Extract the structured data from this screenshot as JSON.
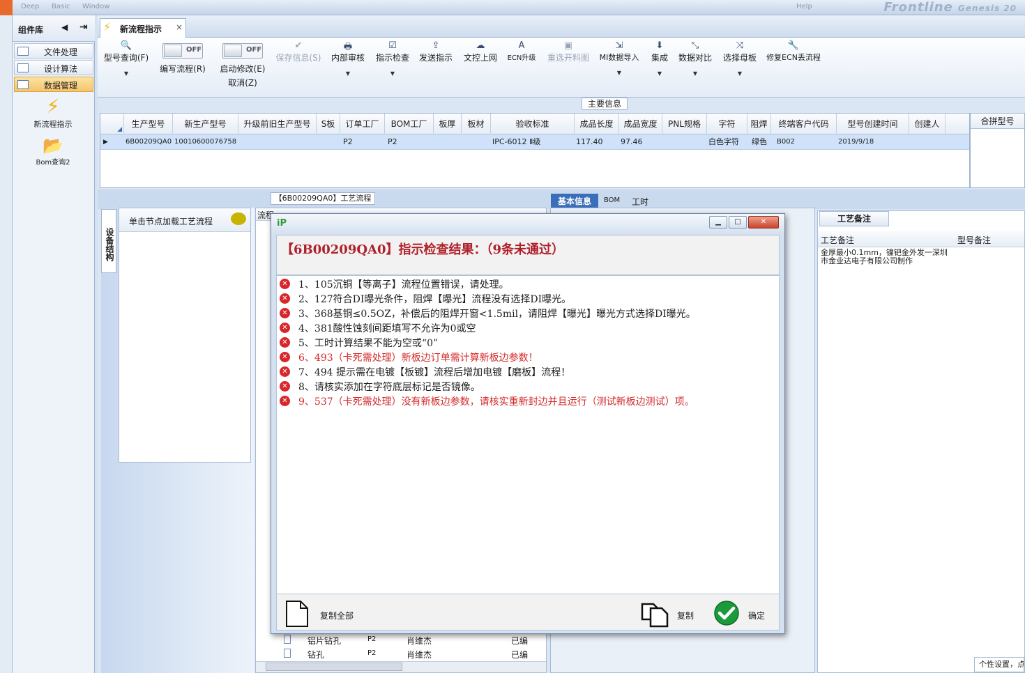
{
  "topbar": {
    "menus": [
      "Deep",
      "Basic",
      "Window"
    ],
    "brand": "Frontline",
    "help": "Help",
    "genesis": "Genesis 20"
  },
  "nav": {
    "title": "组件库",
    "items": [
      "文件处理",
      "设计算法",
      "数据管理"
    ],
    "tools": [
      "新流程指示",
      "Bom查询2"
    ]
  },
  "tab": {
    "label": "新流程指示",
    "close": "×"
  },
  "ribbon": {
    "model_query": "型号查询(F)",
    "write_flow": "编写流程(R)",
    "start_modify": "启动修改(E)",
    "cancel": "取消(Z)",
    "switch_off": "OFF",
    "save_info": "保存信息(S)",
    "internal_review": "内部审核",
    "check": "指示检查",
    "send": "发送指示",
    "upload": "文控上网",
    "ecn_upgrade": "ECN升级",
    "reselect": "重选开料图",
    "mi_import": "MI数据导入",
    "integrate": "集成",
    "compare": "数据对比",
    "mother_board": "选择母板",
    "fix_ecn": "修复ECN丢流程"
  },
  "main_info": {
    "title": "主要信息",
    "headers": [
      "生产型号",
      "新生产型号",
      "升级前旧生产型号",
      "S板",
      "订单工厂",
      "BOM工厂",
      "板厚",
      "板材",
      "验收标准",
      "成品长度",
      "成品宽度",
      "PNL规格",
      "字符",
      "阻焊",
      "终端客户代码",
      "型号创建时间",
      "创建人"
    ],
    "row": [
      "6B00209QA0",
      "10010600076758",
      "",
      "",
      "P2",
      "P2",
      "",
      "",
      "IPC-6012 Ⅱ级",
      "117.40",
      "97.46",
      "",
      "白色字符",
      "绿色",
      "B002",
      "2019/9/18",
      ""
    ],
    "merge_header": "合拼型号"
  },
  "lower": {
    "vtab": "设备结构",
    "load_hint": "单击节点加载工艺流程",
    "process_title": "【6B00209QA0】工艺流程",
    "process_col": "流程",
    "process_rows": [
      {
        "name": "铝片钻孔",
        "factory": "P2",
        "person": "肖维杰",
        "status": "已编"
      },
      {
        "name": "钻孔",
        "factory": "P2",
        "person": "肖维杰",
        "status": "已编"
      }
    ],
    "tabs": [
      "基本信息",
      "BOM",
      "工时"
    ],
    "remark_title": "工艺备注",
    "remark_cols": [
      "工艺备注",
      "型号备注"
    ],
    "remark_text": "金厚最小0.1mm，镍钯金外发一深圳市金业达电子有限公司制作",
    "status_text": "个性设置，点"
  },
  "dialog": {
    "title": "【6B00209QA0】指示检查结果：（9条未通过）",
    "items": [
      {
        "text": "1、105沉铜【等离子】流程位置错误，请处理。",
        "red": false
      },
      {
        "text": "2、127符合DI曝光条件，阻焊【曝光】流程没有选择DI曝光。",
        "red": false
      },
      {
        "text": "3、368基铜≤0.5OZ，补偿后的阻焊开窗<1.5mil，请阻焊【曝光】曝光方式选择DI曝光。",
        "red": false
      },
      {
        "text": "4、381酸性蚀刻间距填写不允许为0或空",
        "red": false
      },
      {
        "text": "5、工时计算结果不能为空或“0”",
        "red": false
      },
      {
        "text": "6、493（卡死需处理）新板边订单需计算新板边参数！",
        "red": true
      },
      {
        "text": "7、494 提示需在电镀【板镀】流程后增加电镀【磨板】流程！",
        "red": false
      },
      {
        "text": "8、请核实添加在字符底层标记是否镜像。",
        "red": false
      },
      {
        "text": "9、537（卡死需处理）没有新板边参数，请核实重新封边并且运行（测试新板边测试）项。",
        "red": true
      }
    ],
    "copy_all": "复制全部",
    "copy": "复制",
    "ok": "确定"
  },
  "colors": {
    "accent": "#f5c46b",
    "error": "#d8262a",
    "title_red": "#b0202a",
    "ok_green": "#1a9a3a"
  }
}
